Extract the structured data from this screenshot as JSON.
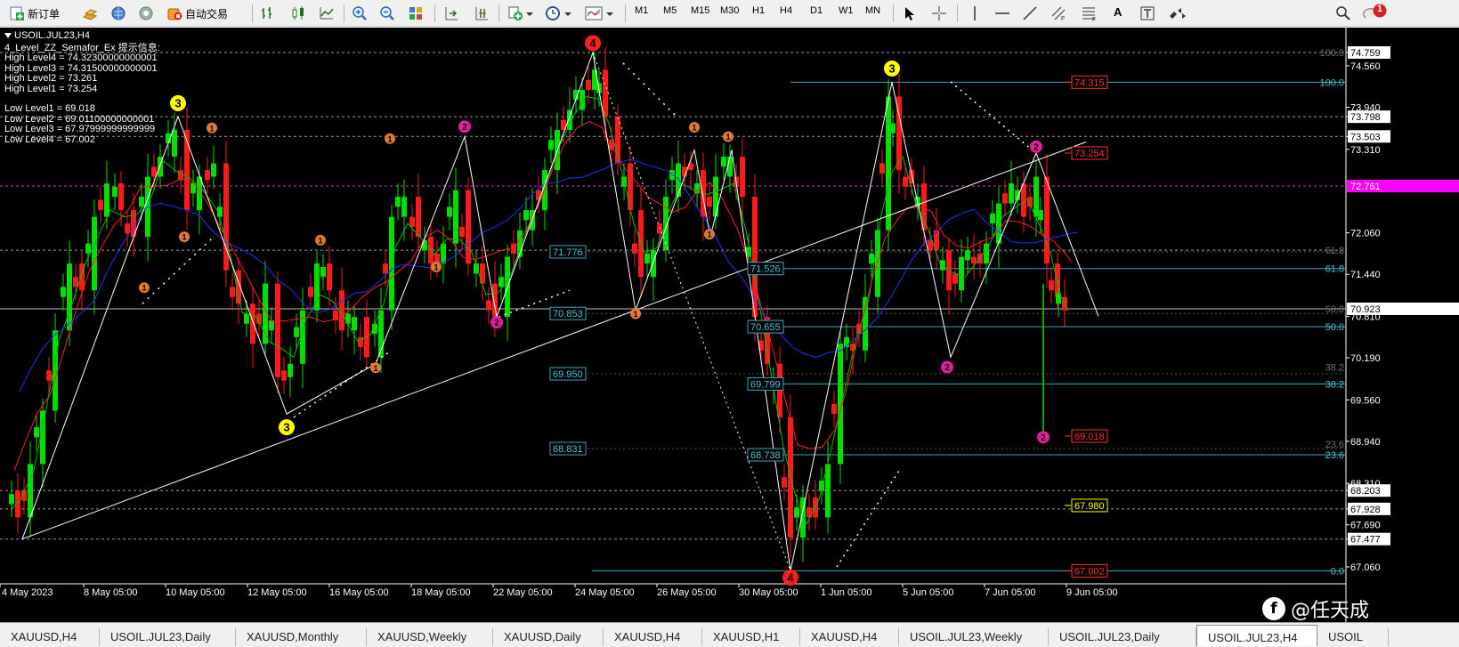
{
  "toolbar": {
    "new_order_label": "新订单",
    "auto_trade_label": "自动交易",
    "timeframes": [
      "M1",
      "M5",
      "M15",
      "M30",
      "H1",
      "H4",
      "D1",
      "W1",
      "MN"
    ],
    "active_timeframe": "H4",
    "text_tool_label": "A",
    "notification_count": "1"
  },
  "chart": {
    "symbol_header": "USOIL.JUL23,H4",
    "indicator_lines": [
      "4_Level_ZZ_Semafor_Ex 提示信息:",
      "High Level4 = 74.32300000000001",
      "High Level3 = 74.31500000000001",
      "High Level2 = 73.261",
      "High Level1 = 73.254",
      "",
      "Low Level1 = 69.018",
      "Low Level2 = 69.01100000000001",
      "Low Level3 = 67.97999999999999",
      "Low Level4 = 67.002"
    ],
    "price_axis": [
      "74.759",
      "74.560",
      "73.940",
      "73.798",
      "73.503",
      "73.310",
      "72.761",
      "72.060",
      "71.440",
      "70.923",
      "70.810",
      "70.190",
      "69.560",
      "68.940",
      "68.310",
      "68.203",
      "67.928",
      "67.690",
      "67.477",
      "67.060"
    ],
    "highlight_prices": [
      {
        "value": "72.761",
        "color": "#ff00ff"
      },
      {
        "value": "70.923",
        "color": "#ffffff"
      }
    ],
    "time_axis": [
      "4 May 2023",
      "8 May 05:00",
      "10 May 05:00",
      "12 May 05:00",
      "16 May 05:00",
      "18 May 05:00",
      "22 May 05:00",
      "24 May 05:00",
      "26 May 05:00",
      "30 May 05:00",
      "1 Jun 05:00",
      "5 Jun 05:00",
      "7 Jun 05:00",
      "9 Jun 05:00"
    ],
    "fib_left_labels": [
      "71.776",
      "70.853",
      "69.950",
      "68.831"
    ],
    "fib_right_labels": [
      "71.526",
      "70.655",
      "69.799",
      "68.738"
    ],
    "fib_levels_right": [
      "100.0",
      "61.8",
      "50.0",
      "38.2",
      "23.6",
      "0.0"
    ],
    "fib_levels_right_alt": [
      "100.0",
      "61.8",
      "50.0",
      "38.2",
      "23.6"
    ],
    "semafor_price_labels": [
      {
        "value": "74.315",
        "color": "#ff3030"
      },
      {
        "value": "73.254",
        "color": "#ff3030"
      },
      {
        "value": "69.018",
        "color": "#ff3030"
      },
      {
        "value": "67.980",
        "color": "#ffff00"
      },
      {
        "value": "67.002",
        "color": "#ff3030"
      }
    ],
    "semafor_marks": [
      {
        "label": "4",
        "color": "#ff2020"
      },
      {
        "label": "3",
        "color": "#ffff00"
      },
      {
        "label": "3",
        "color": "#ffff00"
      },
      {
        "label": "3",
        "color": "#ffff00"
      },
      {
        "label": "4",
        "color": "#ff2020"
      },
      {
        "label": "2",
        "color": "#e0209a"
      },
      {
        "label": "2",
        "color": "#e0209a"
      },
      {
        "label": "2",
        "color": "#e0209a"
      },
      {
        "label": "2",
        "color": "#e0209a"
      },
      {
        "label": "2",
        "color": "#e0209a"
      },
      {
        "label": "1",
        "color": "#e07a30"
      },
      {
        "label": "1",
        "color": "#e07a30"
      },
      {
        "label": "1",
        "color": "#e07a30"
      },
      {
        "label": "1",
        "color": "#e07a30"
      },
      {
        "label": "1",
        "color": "#e07a30"
      },
      {
        "label": "1",
        "color": "#e07a30"
      },
      {
        "label": "1",
        "color": "#e07a30"
      },
      {
        "label": "1",
        "color": "#e07a30"
      },
      {
        "label": "1",
        "color": "#e07a30"
      },
      {
        "label": "1",
        "color": "#e07a30"
      },
      {
        "label": "1",
        "color": "#e07a30"
      }
    ]
  },
  "watermark": {
    "logo": "f",
    "text": "@任天成"
  },
  "tabs": [
    "XAUUSD,H4",
    "USOIL.JUL23,Daily",
    "XAUUSD,Monthly",
    "XAUUSD,Weekly",
    "XAUUSD,Daily",
    "XAUUSD,H4",
    "XAUUSD,H1",
    "XAUUSD,H4",
    "USOIL.JUL23,Weekly",
    "USOIL.JUL23,Daily",
    "USOIL.JUL23,H4",
    "USOIL"
  ],
  "active_tab": "USOIL.JUL23,H4"
}
